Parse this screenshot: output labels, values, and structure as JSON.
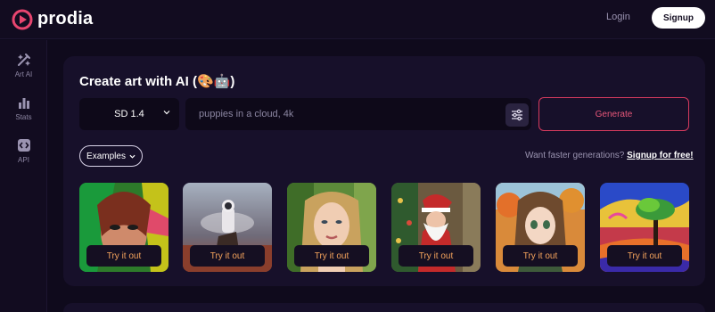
{
  "header": {
    "brand": "prodia",
    "login_label": "Login",
    "signup_label": "Signup"
  },
  "sidebar": {
    "items": [
      {
        "label": "Art AI",
        "icon": "wand-icon"
      },
      {
        "label": "Stats",
        "icon": "bar-chart-icon"
      },
      {
        "label": "API",
        "icon": "code-icon"
      }
    ]
  },
  "main": {
    "title": "Create art with AI (🎨🤖)",
    "model_value": "SD 1.4",
    "prompt_placeholder": "puppies in a cloud, 4k",
    "generate_label": "Generate",
    "examples_label": "Examples",
    "faster_text": "Want faster generations?",
    "faster_link": "Signup for free!"
  },
  "cards": [
    {
      "button": "Try it out",
      "subject": "colorful-woman-portrait"
    },
    {
      "button": "Try it out",
      "subject": "astronaut-on-horse"
    },
    {
      "button": "Try it out",
      "subject": "blonde-woman-portrait"
    },
    {
      "button": "Try it out",
      "subject": "santa-claus"
    },
    {
      "button": "Try it out",
      "subject": "anime-girl-autumn"
    },
    {
      "button": "Try it out",
      "subject": "colorful-tree-landscape"
    }
  ],
  "colors": {
    "accent": "#d63a5e",
    "try_text": "#f4a35c",
    "panel_bg": "#17102a",
    "page_bg": "#0f0a1c"
  }
}
